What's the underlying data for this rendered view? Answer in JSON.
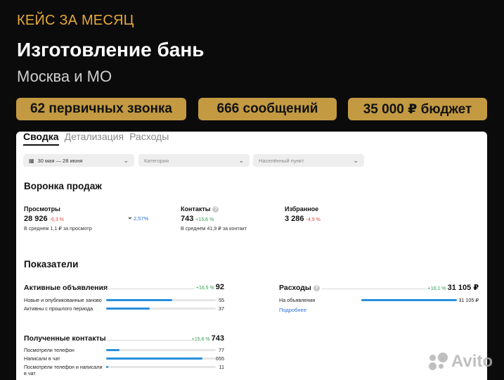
{
  "header": {
    "kicker": "КЕЙС ЗА МЕСЯЦ",
    "title": "Изготовление бань",
    "subtitle": "Москва и МО"
  },
  "stats": [
    {
      "label": "62 первичных звонка"
    },
    {
      "label": "666 сообщений"
    },
    {
      "label": "35 000 ₽ бюджет"
    }
  ],
  "tabs": [
    {
      "label": "Сводка",
      "active": true
    },
    {
      "label": "Детализация",
      "active": false
    },
    {
      "label": "Расходы",
      "active": false
    }
  ],
  "filters": {
    "date": "30 мая — 28 июня",
    "category_placeholder": "Категория",
    "location_placeholder": "Населённый пункт"
  },
  "funnel": {
    "title": "Воронка продаж",
    "views": {
      "label": "Просмотры",
      "value": "28 926",
      "delta": "-6,3 %",
      "note": "В среднем 1,1 ₽ за просмотр"
    },
    "conversion": "2,57%",
    "contacts": {
      "label": "Контакты",
      "value": "743",
      "delta": "+15,6 %",
      "note": "В среднем 41,9 ₽ за контакт"
    },
    "favorites": {
      "label": "Избранное",
      "value": "3 286",
      "delta": "-4,9 %"
    }
  },
  "indicators": {
    "title": "Показатели",
    "active_ads": {
      "title": "Активные объявления",
      "delta": "+16,5 %",
      "total": "92",
      "rows": [
        {
          "label": "Новые и опубликованные заново",
          "value": "55",
          "fraction": 0.6
        },
        {
          "label": "Активны с прошлого периода",
          "value": "37",
          "fraction": 0.4
        }
      ]
    },
    "expenses": {
      "title": "Расходы",
      "delta": "+16,1 %",
      "total": "31 105 ₽",
      "rows": [
        {
          "label": "На объявления",
          "value": "31 105 ₽",
          "fraction": 1.0
        }
      ],
      "link": "Подробнее"
    },
    "contacts": {
      "title": "Полученные контакты",
      "delta": "+15,6 %",
      "total": "743",
      "rows": [
        {
          "label": "Посмотрели телефон",
          "value": "77",
          "fraction": 0.12
        },
        {
          "label": "Написали в чат",
          "value": "655",
          "fraction": 0.88
        },
        {
          "label": "Посмотрели телефон и написали в чат",
          "value": "11",
          "fraction": 0.02
        }
      ]
    }
  },
  "watermark": {
    "text": "Avito"
  },
  "colors": {
    "accent": "#c39a42",
    "kicker": "#e5a83a",
    "bar": "#2a8fdc",
    "positive": "#2e9e4e",
    "negative": "#e04646"
  }
}
